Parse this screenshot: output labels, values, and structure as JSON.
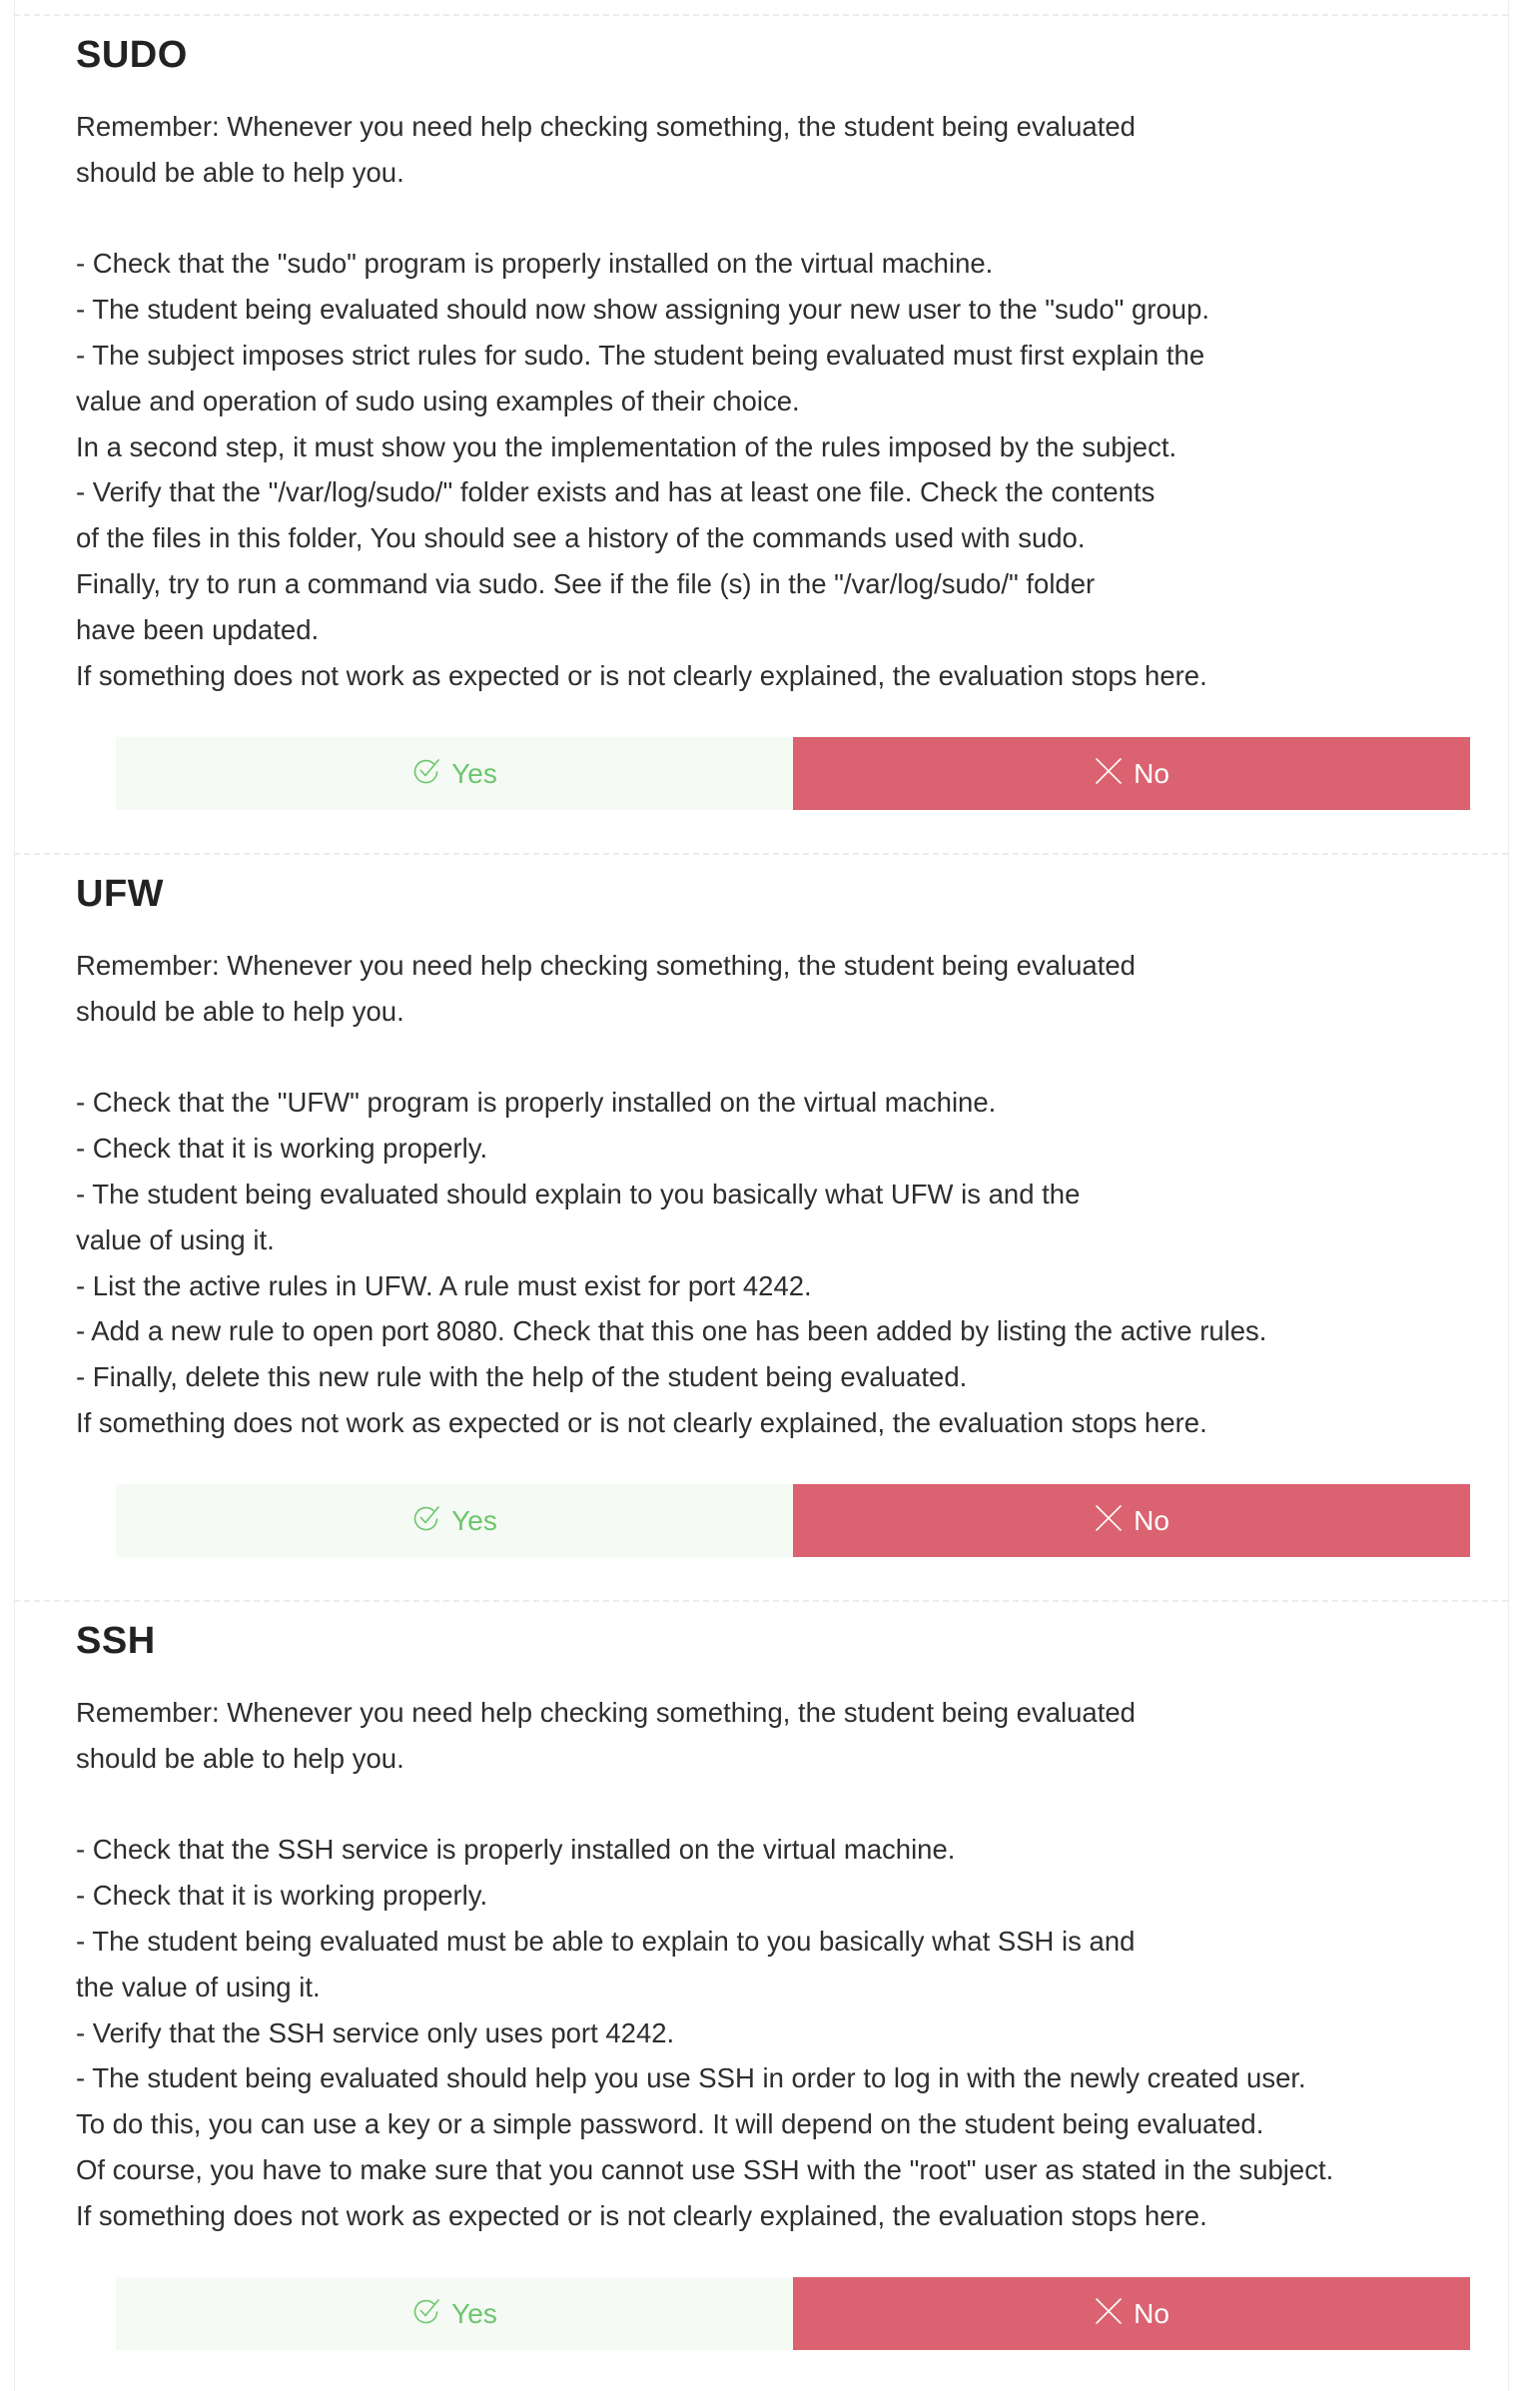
{
  "colors": {
    "yes_bg": "#f5faf4",
    "yes_text": "#6cc66c",
    "no_bg": "#db6270",
    "no_text": "#ffffff",
    "title": "#222222",
    "body": "#2e2e2e"
  },
  "sections": [
    {
      "title": "SUDO",
      "body": "Remember: Whenever you need help checking something, the student being evaluated\nshould be able to help you.\n\n- Check that the \"sudo\" program is properly installed on the virtual machine.\n- The student being evaluated should now show assigning your new user to the \"sudo\" group.\n- The subject imposes strict rules for sudo. The student being evaluated must first explain the\nvalue and operation of sudo using examples of their choice.\nIn a second step, it must show you the implementation of the rules imposed by the subject.\n- Verify that the \"/var/log/sudo/\" folder exists and has at least one file. Check the contents\nof the files in this folder, You should see a history of the commands used with sudo.\nFinally, try to run a command via sudo. See if the file (s) in the \"/var/log/sudo/\" folder\nhave been updated.\nIf something does not work as expected or is not clearly explained, the evaluation stops here.",
      "yes_label": "Yes",
      "no_label": "No",
      "yes_icon": "check-circle-icon",
      "no_icon": "close-icon"
    },
    {
      "title": "UFW",
      "body": "Remember: Whenever you need help checking something, the student being evaluated\nshould be able to help you.\n\n- Check that the \"UFW\" program is properly installed on the virtual machine.\n- Check that it is working properly.\n- The student being evaluated should explain to you basically what UFW is and the\nvalue of using it.\n- List the active rules in UFW. A rule must exist for port 4242.\n- Add a new rule to open port 8080. Check that this one has been added by listing the active rules.\n- Finally, delete this new rule with the help of the student being evaluated.\nIf something does not work as expected or is not clearly explained, the evaluation stops here.",
      "yes_label": "Yes",
      "no_label": "No",
      "yes_icon": "check-circle-icon",
      "no_icon": "close-icon"
    },
    {
      "title": "SSH",
      "body": "Remember: Whenever you need help checking something, the student being evaluated\nshould be able to help you.\n\n- Check that the SSH service is properly installed on the virtual machine.\n- Check that it is working properly.\n- The student being evaluated must be able to explain to you basically what SSH is and\nthe value of using it.\n- Verify that the SSH service only uses port 4242.\n- The student being evaluated should help you use SSH in order to log in with the newly created user.\nTo do this, you can use a key or a simple password. It will depend on the student being evaluated.\nOf course, you have to make sure that you cannot use SSH with the \"root\" user as stated in the subject.\nIf something does not work as expected or is not clearly explained, the evaluation stops here.",
      "yes_label": "Yes",
      "no_label": "No",
      "yes_icon": "check-circle-icon",
      "no_icon": "close-icon"
    }
  ]
}
